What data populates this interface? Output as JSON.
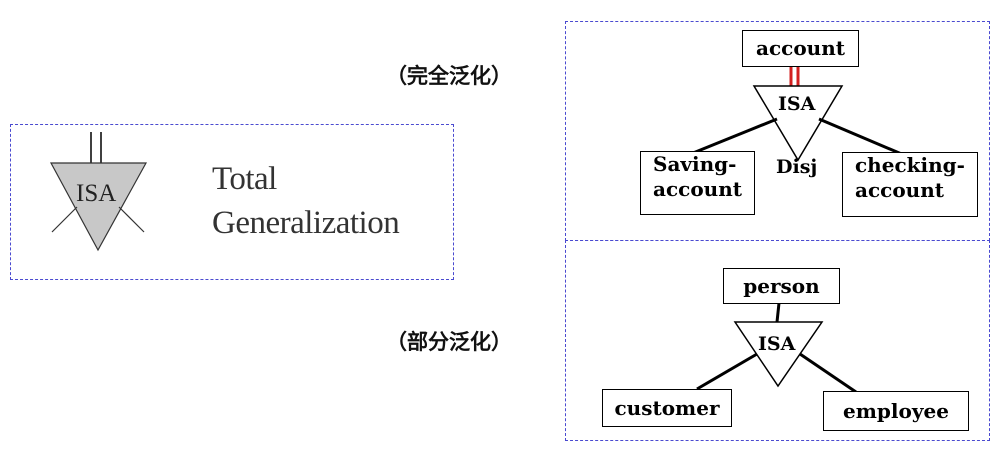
{
  "legend": {
    "symbol_text": "ISA",
    "line1": "Total",
    "line2": "Generalization"
  },
  "labels": {
    "total": "（完全泛化）",
    "partial": "（部分泛化）"
  },
  "total_example": {
    "super": "account",
    "isa": "ISA",
    "constraint": "Disj",
    "sub_left_1": "Saving-",
    "sub_left_2": "account",
    "sub_right_1": "checking-",
    "sub_right_2": "account"
  },
  "partial_example": {
    "super": "person",
    "isa": "ISA",
    "sub_left": "customer",
    "sub_right": "employee"
  },
  "colors": {
    "frame": "#4a4ad0",
    "double_line": "#d32020",
    "triangle_fill": "#c8c8c8"
  }
}
